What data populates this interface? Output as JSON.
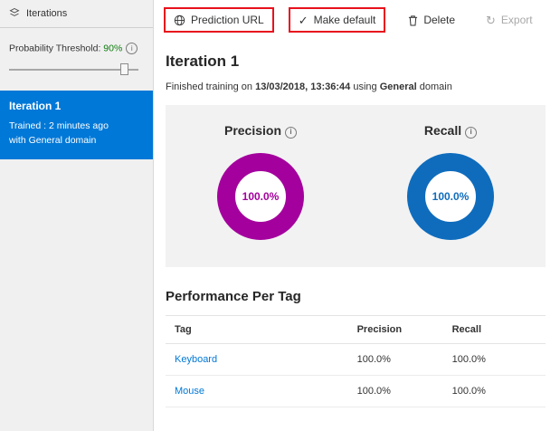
{
  "sidebar": {
    "title": "Iterations",
    "threshold_label": "Probability Threshold:",
    "threshold_value": "90%",
    "iteration": {
      "name": "Iteration 1",
      "trained_line": "Trained : 2 minutes ago",
      "domain_line": "with General domain"
    }
  },
  "toolbar": {
    "prediction_url": "Prediction URL",
    "make_default": "Make default",
    "delete": "Delete",
    "export": "Export"
  },
  "main": {
    "title": "Iteration 1",
    "training": {
      "prefix": "Finished training on",
      "datetime": "13/03/2018, 13:36:44",
      "using": "using",
      "domain": "General",
      "suffix": "domain"
    },
    "performance_title": "Performance Per Tag"
  },
  "chart_data": [
    {
      "type": "pie",
      "title": "Precision",
      "labels": [
        "Precision"
      ],
      "values": [
        100.0
      ],
      "display_value": "100.0%",
      "color": "#a4009d"
    },
    {
      "type": "pie",
      "title": "Recall",
      "labels": [
        "Recall"
      ],
      "values": [
        100.0
      ],
      "display_value": "100.0%",
      "color": "#0f6cbd"
    }
  ],
  "table": {
    "headers": [
      "Tag",
      "Precision",
      "Recall"
    ],
    "rows": [
      {
        "tag": "Keyboard",
        "precision": "100.0%",
        "recall": "100.0%"
      },
      {
        "tag": "Mouse",
        "precision": "100.0%",
        "recall": "100.0%"
      }
    ]
  },
  "icons": {
    "info": "i",
    "check": "✓",
    "export": "↻"
  },
  "colors": {
    "accent_blue": "#0078d7",
    "precision_purple": "#a4009d",
    "recall_blue": "#0f6cbd",
    "annotation_red": "#e8111c"
  }
}
